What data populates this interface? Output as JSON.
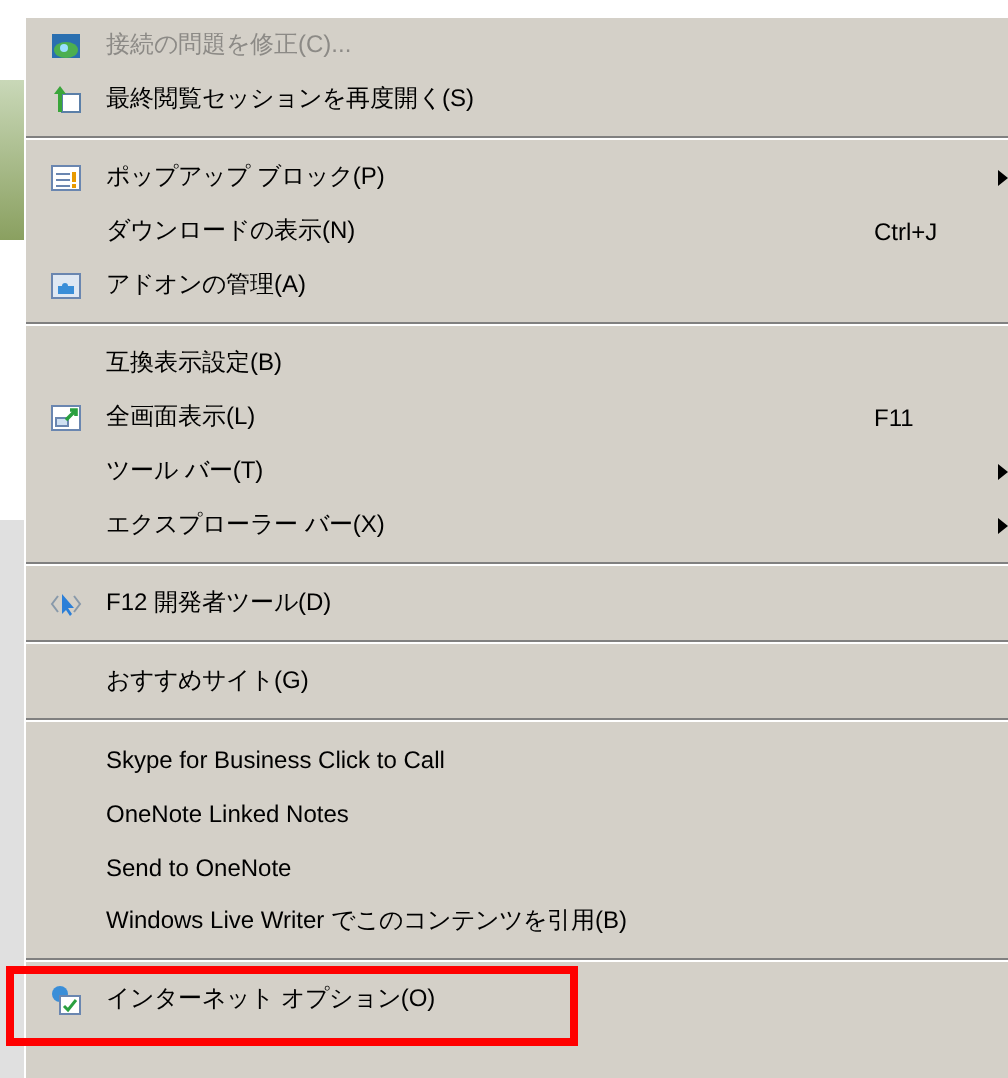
{
  "menu": {
    "sections": [
      {
        "items": [
          {
            "label": "接続の問題を修正(C)...",
            "submenu": false,
            "disabled": true,
            "highlighted": false
          },
          {
            "label": "最終閲覧セッションを再度開く(S)",
            "submenu": false,
            "disabled": false,
            "highlighted": false
          }
        ]
      },
      {
        "items": [
          {
            "label": "ポップアップ ブロック(P)",
            "submenu": true,
            "disabled": false,
            "highlighted": false
          },
          {
            "label": "ダウンロードの表示(N)",
            "shortcut": "Ctrl+J",
            "submenu": false,
            "disabled": false,
            "highlighted": false
          },
          {
            "label": "アドオンの管理(A)",
            "submenu": false,
            "disabled": false,
            "highlighted": false
          }
        ]
      },
      {
        "items": [
          {
            "label": "互換表示設定(B)",
            "submenu": false,
            "disabled": false,
            "highlighted": false
          },
          {
            "label": "全画面表示(L)",
            "shortcut": "F11",
            "submenu": false,
            "disabled": false,
            "highlighted": false
          },
          {
            "label": "ツール バー(T)",
            "submenu": true,
            "disabled": false,
            "highlighted": false
          },
          {
            "label": "エクスプローラー バー(X)",
            "submenu": true,
            "disabled": false,
            "highlighted": false
          }
        ]
      },
      {
        "items": [
          {
            "label": "F12 開発者ツール(D)",
            "submenu": false,
            "disabled": false,
            "highlighted": false
          }
        ]
      },
      {
        "items": [
          {
            "label": "おすすめサイト(G)",
            "submenu": false,
            "disabled": false,
            "highlighted": false
          }
        ]
      },
      {
        "items": [
          {
            "label": "Skype for Business Click to Call",
            "submenu": false,
            "disabled": false,
            "highlighted": false
          },
          {
            "label": "OneNote Linked Notes",
            "submenu": false,
            "disabled": false,
            "highlighted": false
          },
          {
            "label": "Send to OneNote",
            "submenu": false,
            "disabled": false,
            "highlighted": false
          },
          {
            "label": "Windows Live Writer でこのコンテンツを引用(B)",
            "submenu": false,
            "disabled": false,
            "highlighted": false
          }
        ]
      },
      {
        "items": [
          {
            "label": "インターネット オプション(O)",
            "submenu": false,
            "disabled": false,
            "highlighted": true
          }
        ]
      }
    ]
  }
}
